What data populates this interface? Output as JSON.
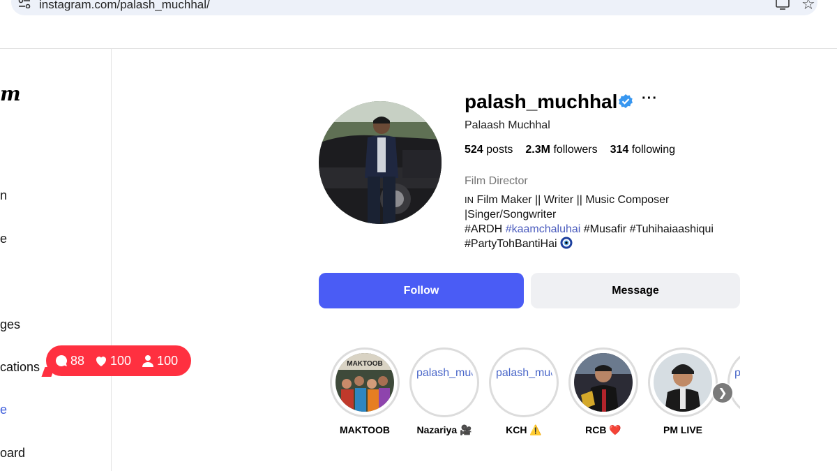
{
  "browser": {
    "url": "instagram.com/palash_muchhal/"
  },
  "sidebar": {
    "logo_fragment": "m",
    "items": [
      {
        "label": "n"
      },
      {
        "label": "e"
      },
      {
        "label": "ges"
      },
      {
        "label": "cations"
      },
      {
        "label": "e"
      },
      {
        "label": "oard"
      }
    ]
  },
  "notifications": {
    "comments": "88",
    "likes": "100",
    "follows": "100",
    "color": "#ff3040"
  },
  "profile": {
    "username": "palash_muchhal",
    "full_name": "Palaash Muchhal",
    "more_icon": "···",
    "stats": {
      "posts_count": "524",
      "posts_label": "posts",
      "followers_count": "2.3M",
      "followers_label": "followers",
      "following_count": "314",
      "following_label": "following"
    },
    "category": "Film Director",
    "bio": {
      "flag": "IN",
      "line1": " Film Maker || Writer || Music Composer",
      "line2": "|Singer/Songwriter",
      "hash1": "#ARDH",
      "hash2": "#kaamchaluhai",
      "hash3": "#Musafir",
      "hash4": "#Tuhihaiaashiqui",
      "hash5": "#PartyTohBantiHai"
    },
    "follow_label": "Follow",
    "message_label": "Message",
    "accent": "#4a5cf5"
  },
  "highlights": [
    {
      "label": "MAKTOOB",
      "cover_text": "MAKTOOB"
    },
    {
      "label": "Nazariya 🎥",
      "alt": "palash_muchhal's highlight story picture"
    },
    {
      "label": "KCH ⚠️",
      "alt": "palash_muchhal's highlight story picture"
    },
    {
      "label": "RCB ❤️"
    },
    {
      "label": "PM LIVE"
    },
    {
      "alt": "palash_muchhal's highlight story picture"
    }
  ]
}
